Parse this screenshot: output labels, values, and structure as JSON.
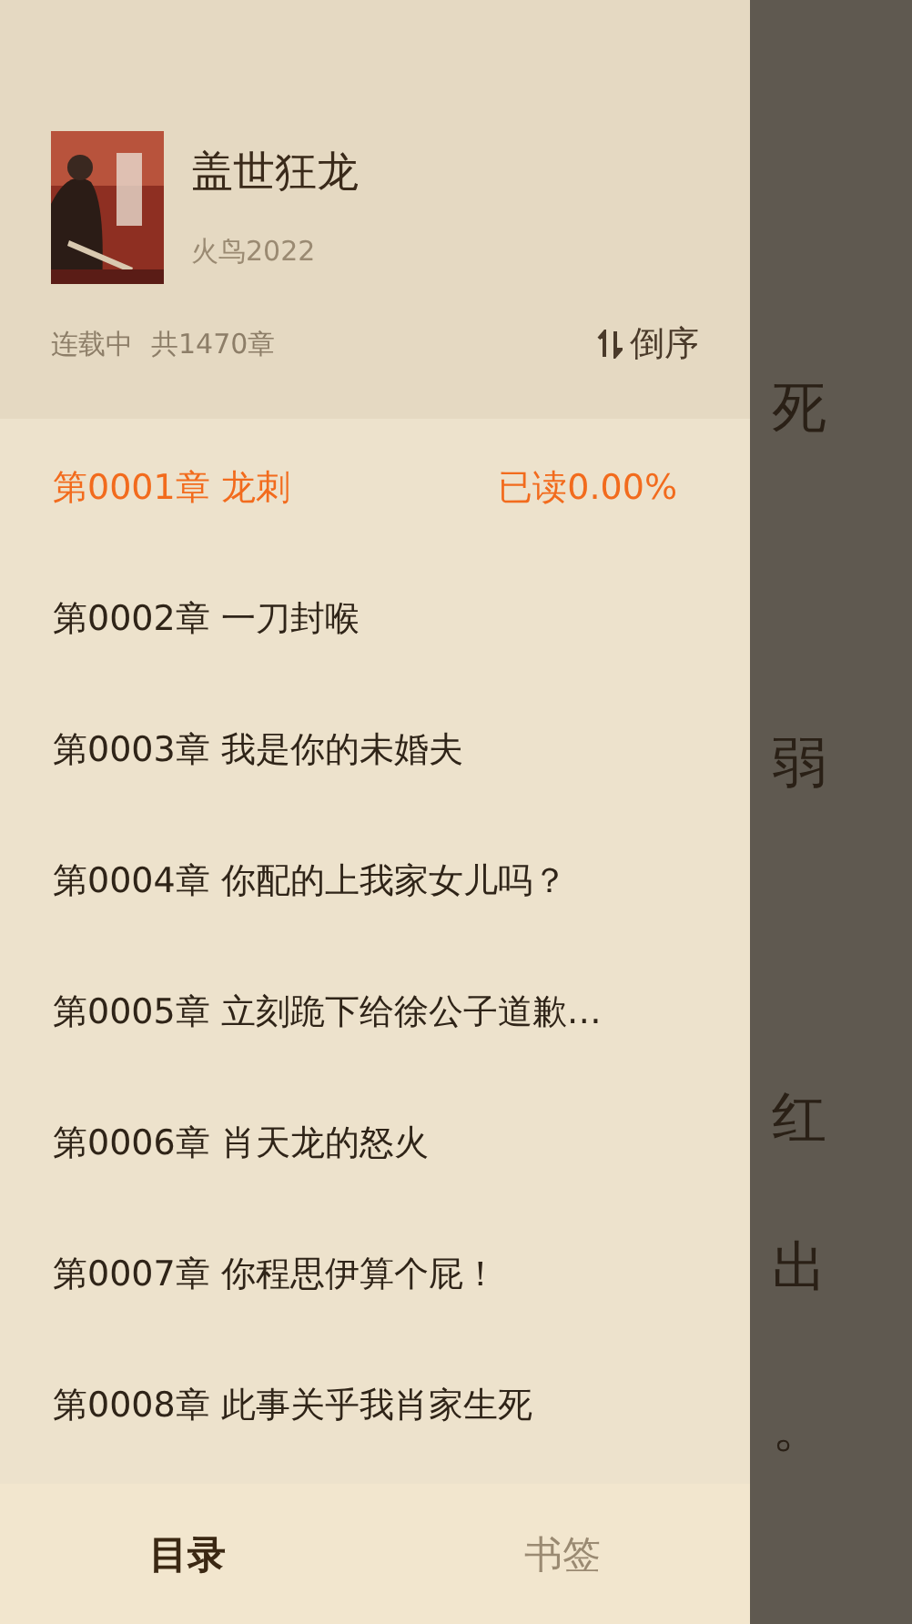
{
  "reader_background": {
    "lines": [
      {
        "text": "死"
      },
      {
        "text": "弱"
      },
      {
        "text": "红"
      },
      {
        "text": "出"
      },
      {
        "text": "。"
      }
    ]
  },
  "book": {
    "title": "盖世狂龙",
    "author": "火鸟2022",
    "status": "连载中",
    "chapter_count": "共1470章",
    "sort_button": "倒序"
  },
  "chapters": [
    {
      "title": "第0001章 龙刺",
      "selected": true,
      "progress": "已读0.00%"
    },
    {
      "title": "第0002章 一刀封喉",
      "selected": false
    },
    {
      "title": "第0003章 我是你的未婚夫",
      "selected": false
    },
    {
      "title": "第0004章 你配的上我家女儿吗？",
      "selected": false
    },
    {
      "title": "第0005章 立刻跪下给徐公子道歉…",
      "selected": false
    },
    {
      "title": "第0006章 肖天龙的怒火",
      "selected": false
    },
    {
      "title": "第0007章 你程思伊算个屁！",
      "selected": false
    },
    {
      "title": "第0008章 此事关乎我肖家生死",
      "selected": false
    }
  ],
  "tabs": [
    {
      "label": "目录",
      "selected": true
    },
    {
      "label": "书签",
      "selected": false
    }
  ]
}
